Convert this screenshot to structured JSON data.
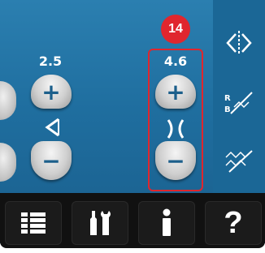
{
  "stitch_length": {
    "value": "2.5",
    "plus_label": "+",
    "minus_label": "−"
  },
  "stitch_width": {
    "value": "4.6",
    "plus_label": "+",
    "minus_label": "−"
  },
  "callout": {
    "number": "14"
  },
  "toolbar": {
    "help_label": "?"
  },
  "icons": {
    "length_icon": "arrow-left-icon",
    "width_icon": "width-icon",
    "mirror_icon": "mirror-icon",
    "balance_icon": "balance-icon",
    "stitch_icon": "stitch-icon",
    "menu_icon": "menu-icon",
    "settings_icon": "settings-icon",
    "info_icon": "info-icon",
    "help_icon": "help-icon"
  },
  "colors": {
    "panel": "#1f6e9f",
    "highlight": "#e0262e",
    "toolbar": "#111111"
  }
}
